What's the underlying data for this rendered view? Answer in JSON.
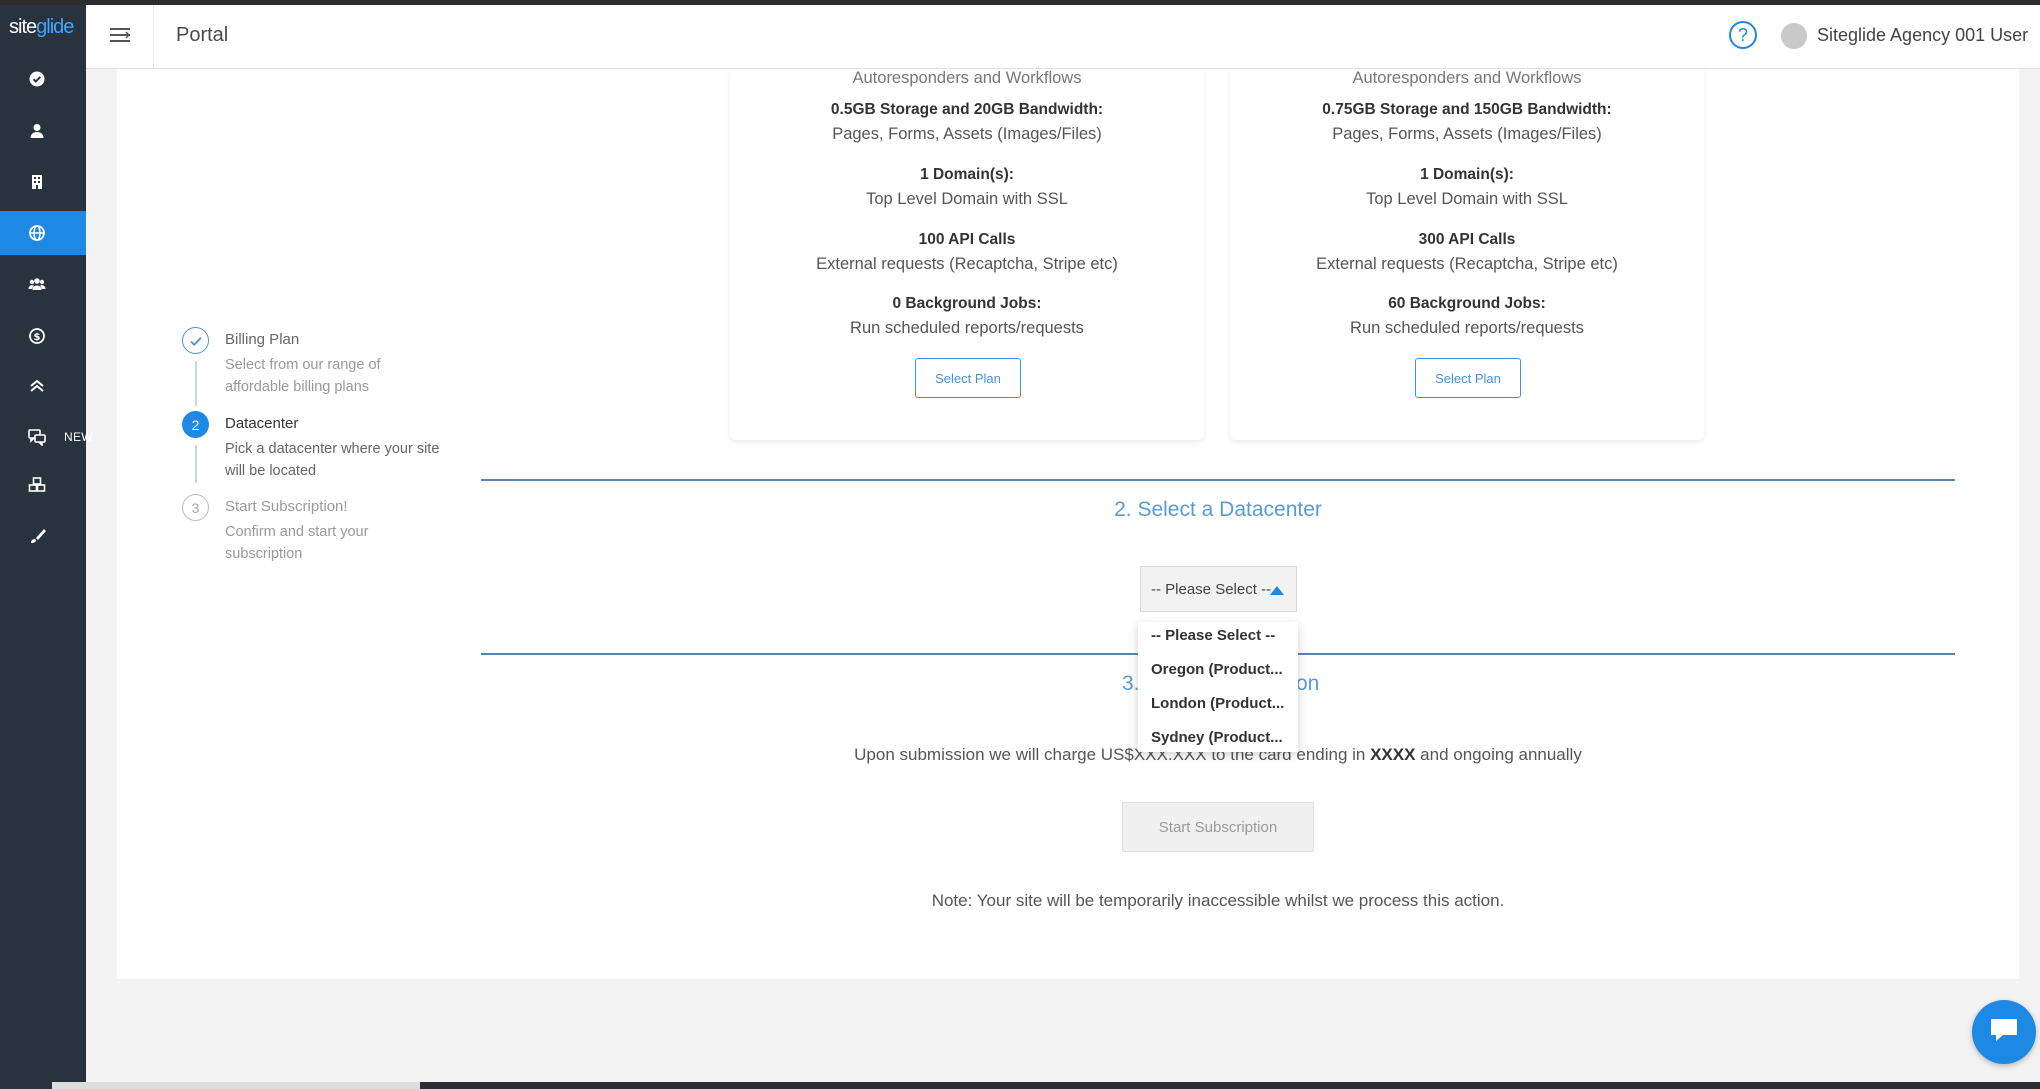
{
  "app": {
    "logo_site": "site",
    "logo_glide": "glide",
    "page_title": "Portal",
    "help_glyph": "?",
    "user_name": "Siteglide Agency 001 User"
  },
  "sidebar": {
    "items": [
      {
        "icon": "check-circle-icon"
      },
      {
        "icon": "user-icon"
      },
      {
        "icon": "building-icon"
      },
      {
        "icon": "globe-icon",
        "active": true
      },
      {
        "icon": "users-icon"
      },
      {
        "icon": "dollar-circle-icon"
      },
      {
        "icon": "double-chevron-up-icon"
      },
      {
        "icon": "comments-icon",
        "badge": "NEW"
      },
      {
        "icon": "cubes-icon"
      },
      {
        "icon": "brush-icon"
      }
    ],
    "accent": "#1e88e5"
  },
  "stepper": [
    {
      "number": "",
      "title": "Billing Plan",
      "description": "Select from our range of affordable billing plans",
      "state": "done"
    },
    {
      "number": "2",
      "title": "Datacenter",
      "description": "Pick a datacenter where your site will be located",
      "state": "current"
    },
    {
      "number": "3",
      "title": "Start Subscription!",
      "description": "Confirm and start your subscription",
      "state": "todo"
    }
  ],
  "plans": [
    {
      "top_text": "Autoresponders and Workflows",
      "storage_title": "0.5GB Storage and 20GB Bandwidth:",
      "storage_desc": "Pages, Forms, Assets (Images/Files)",
      "domain_title": "1 Domain(s):",
      "domain_desc": "Top Level Domain with SSL",
      "api_title": "100 API Calls",
      "api_desc": "External requests (Recaptcha, Stripe etc)",
      "jobs_title": "0 Background Jobs:",
      "jobs_desc": "Run scheduled reports/requests",
      "button": "Select Plan"
    },
    {
      "top_text": "Autoresponders and Workflows",
      "storage_title": "0.75GB Storage and 150GB Bandwidth:",
      "storage_desc": "Pages, Forms, Assets (Images/Files)",
      "domain_title": "1 Domain(s):",
      "domain_desc": "Top Level Domain with SSL",
      "api_title": "300 API Calls",
      "api_desc": "External requests (Recaptcha, Stripe etc)",
      "jobs_title": "60 Background Jobs:",
      "jobs_desc": "Run scheduled reports/requests",
      "button": "Select Plan"
    }
  ],
  "datacenter": {
    "section_title": "2. Select a Datacenter",
    "selected": "-- Please Select --",
    "options": [
      "-- Please Select --",
      "Oregon (Product...",
      "London (Product...",
      "Sydney (Product..."
    ]
  },
  "subscription": {
    "section_title_left": "3.",
    "section_title_right": "on",
    "charge_prefix": "Upon submission we will charge US$XXX.XXX to the card ending in ",
    "card_ending": "XXXX",
    "charge_suffix": " and ongoing annually",
    "button": "Start Subscription",
    "note": "Note: Your site will be temporarily inaccessible whilst we process this action."
  }
}
